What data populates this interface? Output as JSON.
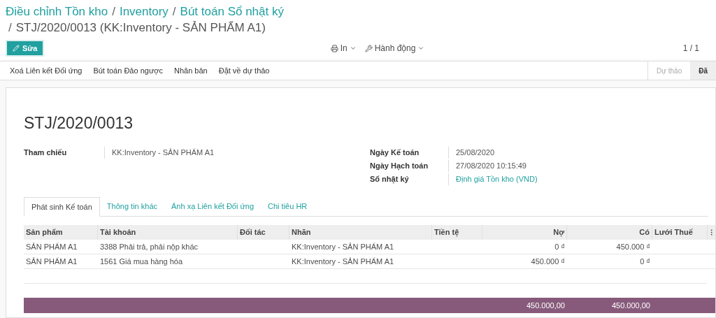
{
  "breadcrumb": {
    "links": [
      "Điều chỉnh Tồn kho",
      "Inventory",
      "Bút toán Sổ nhật ký"
    ],
    "separators": [
      "/",
      "/",
      "/"
    ],
    "current": "STJ/2020/0013 (KK:Inventory - SẢN PHẨM A1)"
  },
  "toolbar": {
    "edit_button": "Sửa",
    "print": "In",
    "action": "Hành động",
    "pager": "1 / 1"
  },
  "action_buttons": [
    "Xoá Liên kết Đối ứng",
    "Bút toán Đảo ngược",
    "Nhân bản",
    "Đặt về dự thảo"
  ],
  "stages": [
    {
      "label": "Dự thảo",
      "selected": false
    },
    {
      "label": "Đã",
      "selected": true
    }
  ],
  "title": "STJ/2020/0013",
  "left_fields": [
    {
      "label": "Tham chiếu",
      "value": "KK:Inventory - SẢN PHẨM A1",
      "kind": "text"
    }
  ],
  "right_fields": [
    {
      "label": "Ngày Kế toán",
      "value": "25/08/2020",
      "kind": "text"
    },
    {
      "label": "Ngày Hạch toán",
      "value": "27/08/2020 10:15:49",
      "kind": "text"
    },
    {
      "label": "Sổ nhật ký",
      "value": "Định giá Tồn kho (VND)",
      "kind": "link"
    }
  ],
  "tabs": [
    {
      "label": "Phát sinh Kế toán",
      "selected": true
    },
    {
      "label": "Thông tin khác",
      "selected": false
    },
    {
      "label": "Ánh xạ Liên kết Đối ứng",
      "selected": false
    },
    {
      "label": "Chi tiêu HR",
      "selected": false
    }
  ],
  "table": {
    "columns": [
      "Sản phẩm",
      "Tài khoản",
      "Đối tác",
      "Nhãn",
      "Tiền tệ",
      "Nợ",
      "Có",
      "Lưới Thuế"
    ],
    "rows": [
      [
        "SẢN PHẨM A1",
        "3388 Phải trả, phải nộp khác",
        "",
        "KK:Inventory - SẢN PHẨM A1",
        "",
        "0 ₫",
        "450.000 ₫",
        ""
      ],
      [
        "SẢN PHẨM A1",
        "1561 Giá mua hàng hóa",
        "",
        "KK:Inventory - SẢN PHẨM A1",
        "",
        "450.000 ₫",
        "0 ₫",
        ""
      ]
    ],
    "totals": {
      "debit": "450.000,00",
      "credit": "450.000,00"
    }
  }
}
